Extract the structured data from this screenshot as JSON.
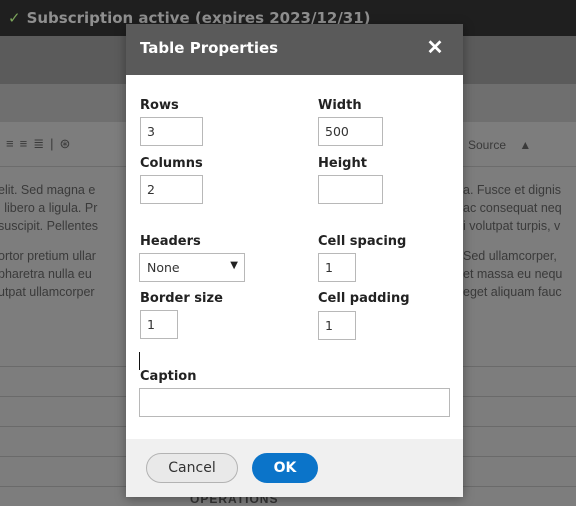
{
  "background": {
    "status": "Subscription active (expires 2023/12/31)",
    "toolbar_right": "Source",
    "text_left": [
      "elit. Sed magna e",
      "i libero a ligula. Pr",
      "suscipit. Pellentes",
      "",
      "ortor pretium ullar",
      "pharetra nulla eu",
      "utpat ullamcorper"
    ],
    "text_right": [
      "a. Fusce et dignis",
      "ac consequat neq",
      "i volutpat turpis, v",
      "",
      "Sed ullamcorper,",
      "et massa eu nequ",
      "eget aliquam fauc"
    ],
    "operations": "OPERATIONS"
  },
  "dialog": {
    "title": "Table Properties",
    "rows_label": "Rows",
    "rows_value": "3",
    "columns_label": "Columns",
    "columns_value": "2",
    "width_label": "Width",
    "width_value": "500",
    "height_label": "Height",
    "height_value": "",
    "headers_label": "Headers",
    "headers_value": "None",
    "border_label": "Border size",
    "border_value": "1",
    "spacing_label": "Cell spacing",
    "spacing_value": "1",
    "padding_label": "Cell padding",
    "padding_value": "1",
    "caption_label": "Caption",
    "caption_value": "",
    "cancel_label": "Cancel",
    "ok_label": "OK"
  }
}
